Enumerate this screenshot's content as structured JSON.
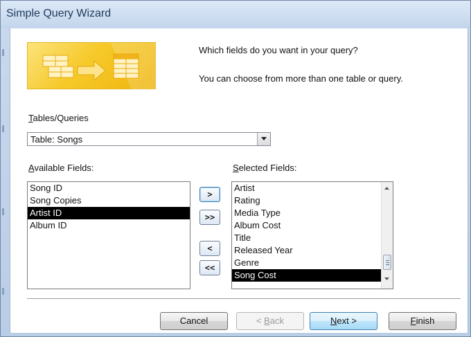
{
  "window": {
    "title": "Simple Query Wizard"
  },
  "prompt": {
    "line1": "Which fields do you want in your query?",
    "line2": "You can choose from more than one table or query."
  },
  "tables_queries": {
    "label_accel": "T",
    "label_rest": "ables/Queries",
    "selected": "Table: Songs"
  },
  "available_fields": {
    "label_accel": "A",
    "label_rest": "vailable Fields:",
    "items": [
      "Song ID",
      "Song Copies",
      "Artist ID",
      "Album ID"
    ],
    "selected_index": 2
  },
  "selected_fields": {
    "label_accel": "S",
    "label_rest": "elected Fields:",
    "items": [
      "Artist",
      "Rating",
      "Media Type",
      "Album Cost",
      "Title",
      "Released Year",
      "Genre",
      "Song Cost"
    ],
    "selected_index": 7
  },
  "move_buttons": {
    "add_one": ">",
    "add_all": ">>",
    "remove_one": "<",
    "remove_all": "<<"
  },
  "buttons": {
    "cancel": "Cancel",
    "back_pre": "< ",
    "back_accel": "B",
    "back_rest": "ack",
    "next_accel": "N",
    "next_rest": "ext >",
    "finish_accel": "F",
    "finish_rest": "inish"
  },
  "colors": {
    "selection_bg": "#000000",
    "selection_fg": "#ffffff",
    "wizard_gold": "#f6c92a"
  }
}
